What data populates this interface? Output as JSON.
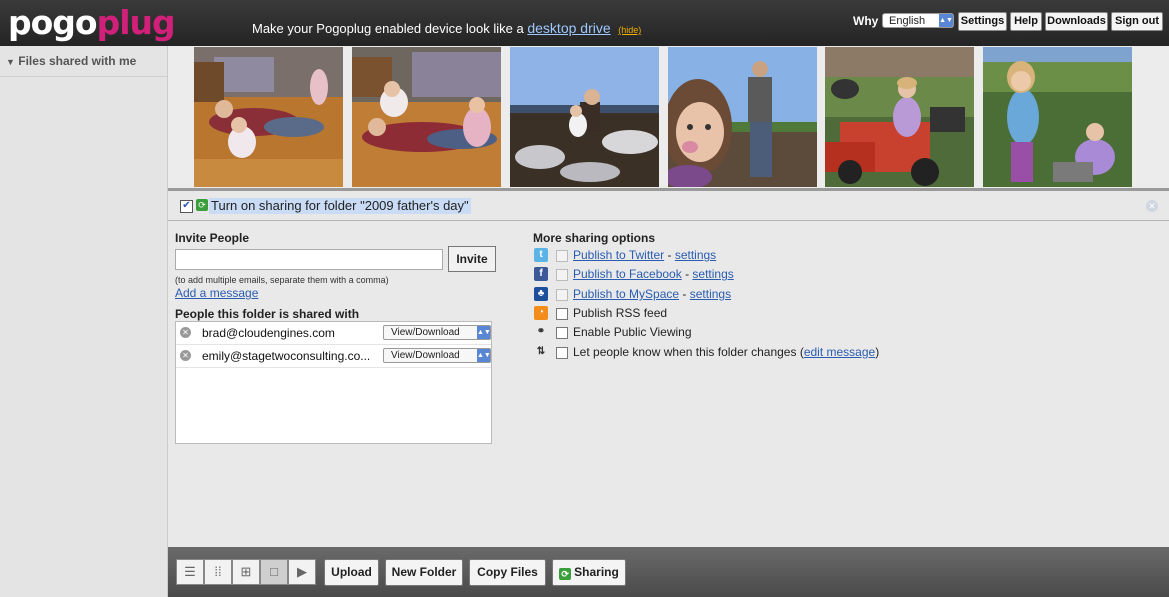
{
  "header": {
    "logo_part1": "pogo",
    "logo_part2": "plug",
    "promo_text": "Make your Pogoplug enabled device look like a",
    "promo_link": "desktop drive",
    "promo_hide": "(hide)",
    "why_label": "Why",
    "language_selected": "English",
    "nav": [
      "Settings",
      "Help",
      "Downloads",
      "Sign out"
    ]
  },
  "sidebar": {
    "section_title": "Files shared with me"
  },
  "share_toggle": {
    "label": "Turn on sharing for folder \"2009 father's day\"",
    "checked": true
  },
  "invite": {
    "title": "Invite People",
    "input_value": "",
    "button": "Invite",
    "hint": "(to add multiple emails, separate them with a comma)",
    "add_message": "Add a message"
  },
  "shared_with": {
    "title": "People this folder is shared with",
    "people": [
      {
        "email": "brad@cloudengines.com",
        "permission": "View/Download"
      },
      {
        "email": "emily@stagetwoconsulting.co...",
        "permission": "View/Download"
      }
    ]
  },
  "more_options": {
    "title": "More sharing options",
    "twitter": {
      "label": "Publish to Twitter",
      "settings": "settings",
      "icon": "twitter-icon",
      "color": "#5bb4e5"
    },
    "facebook": {
      "label": "Publish to Facebook",
      "settings": "settings",
      "icon": "facebook-icon",
      "color": "#3b5998"
    },
    "myspace": {
      "label": "Publish to MySpace",
      "settings": "settings",
      "icon": "myspace-icon",
      "color": "#1d4f9a"
    },
    "rss": {
      "label": "Publish RSS feed",
      "icon": "rss-icon",
      "color": "#f28c1b"
    },
    "public": {
      "label": "Enable Public Viewing",
      "icon": "link-icon"
    },
    "notify": {
      "label_pre": "Let people know when this folder changes (",
      "link": "edit message",
      "label_post": ")",
      "icon": "refresh-icon"
    }
  },
  "toolbar": {
    "view_icons": [
      "list-view-icon",
      "small-grid-icon",
      "large-grid-icon",
      "single-view-icon",
      "slideshow-play-icon"
    ],
    "upload": "Upload",
    "new_folder": "New Folder",
    "copy_files": "Copy Files",
    "sharing": "Sharing"
  },
  "colors": {
    "brand_pink": "#d0207a",
    "link": "#2a5db0",
    "highlight": "#c9dbf5"
  }
}
